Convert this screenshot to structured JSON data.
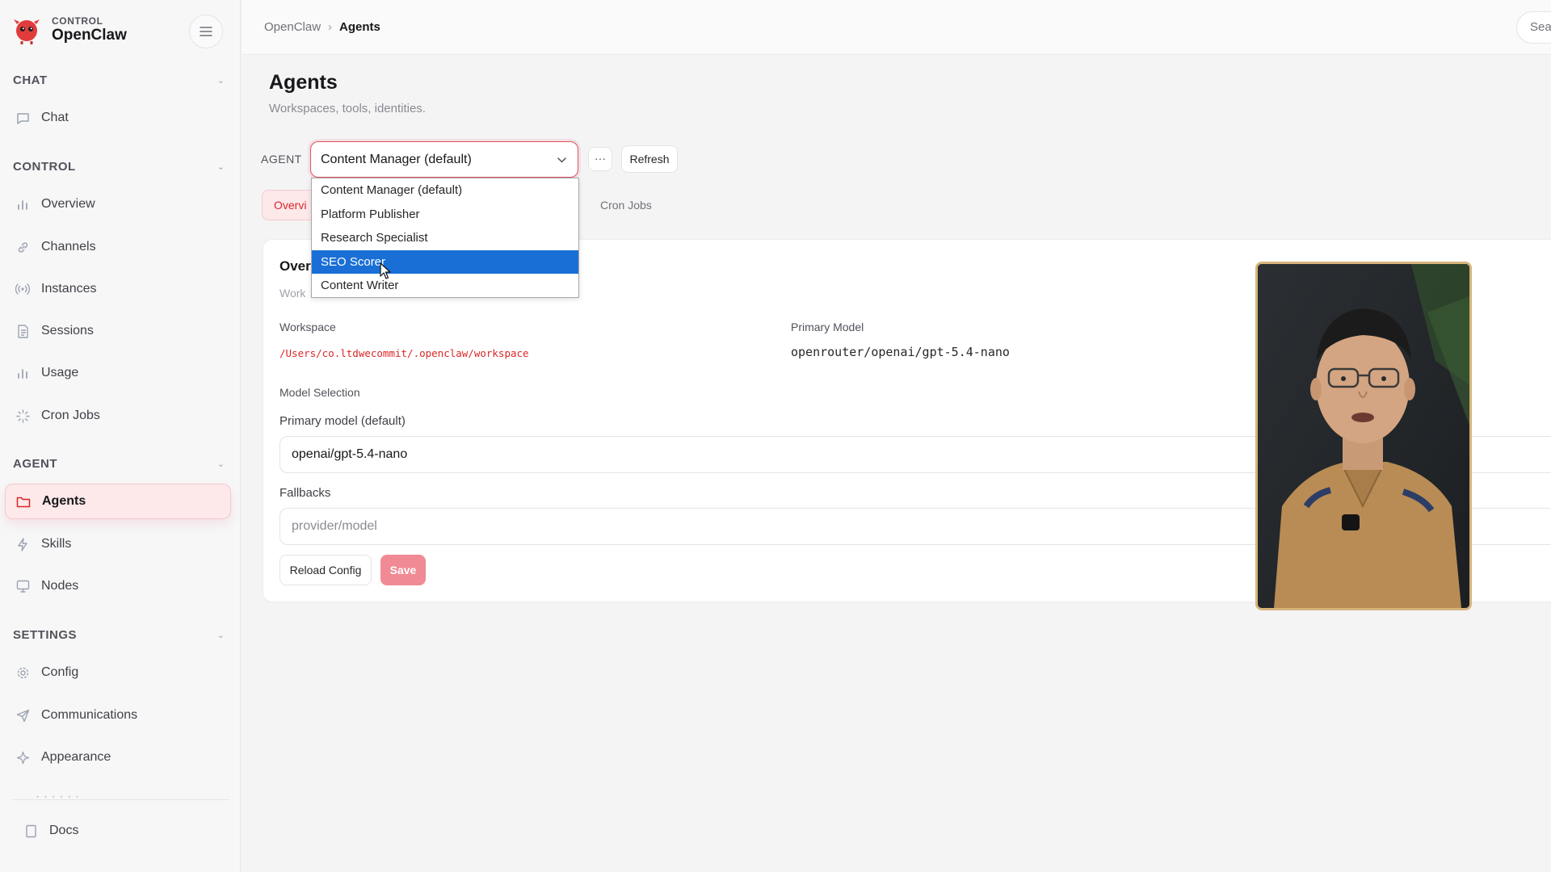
{
  "brand": {
    "subtitle": "CONTROL",
    "title": "OpenClaw"
  },
  "sidebar": {
    "sections": {
      "chat": "CHAT",
      "control": "CONTROL",
      "agent": "AGENT",
      "settings": "SETTINGS"
    },
    "items": {
      "chat": "Chat",
      "overview": "Overview",
      "channels": "Channels",
      "instances": "Instances",
      "sessions": "Sessions",
      "usage": "Usage",
      "cron_jobs": "Cron Jobs",
      "agents": "Agents",
      "skills": "Skills",
      "nodes": "Nodes",
      "config": "Config",
      "communications": "Communications",
      "appearance": "Appearance",
      "docs": "Docs"
    }
  },
  "header": {
    "breadcrumb_root": "OpenClaw",
    "breadcrumb_sep": "›",
    "breadcrumb_current": "Agents",
    "search_placeholder": "Sear"
  },
  "page": {
    "title": "Agents",
    "subtitle": "Workspaces, tools, identities.",
    "agent_label": "AGENT",
    "selected_agent": "Content Manager (default)",
    "more_label": "···",
    "refresh_label": "Refresh"
  },
  "tabs": {
    "overview": "Overvi",
    "cron_jobs": "Cron Jobs"
  },
  "overview_card": {
    "title": "Over",
    "subtitle": "Work",
    "workspace_label": "Workspace",
    "workspace_path": "/Users/co.ltdwecommit/.openclaw/workspace",
    "primary_model_label": "Primary Model",
    "primary_model_value": "openrouter/openai/gpt-5.4-nano",
    "model_selection_label": "Model Selection",
    "primary_model_default_label": "Primary model (default)",
    "primary_model_input": "openai/gpt-5.4-nano",
    "fallbacks_label": "Fallbacks",
    "fallbacks_placeholder": "provider/model",
    "reload_label": "Reload Config",
    "save_label": "Save"
  },
  "dropdown": {
    "options": [
      "Content Manager (default)",
      "Platform Publisher",
      "Research Specialist",
      "SEO Scorer",
      "Content Writer"
    ],
    "highlighted_index": 3
  },
  "colors": {
    "accent": "#dc2626",
    "active_bg": "#fde8ea",
    "highlight_blue": "#1a6fd6",
    "save_bg": "#f08a94"
  }
}
